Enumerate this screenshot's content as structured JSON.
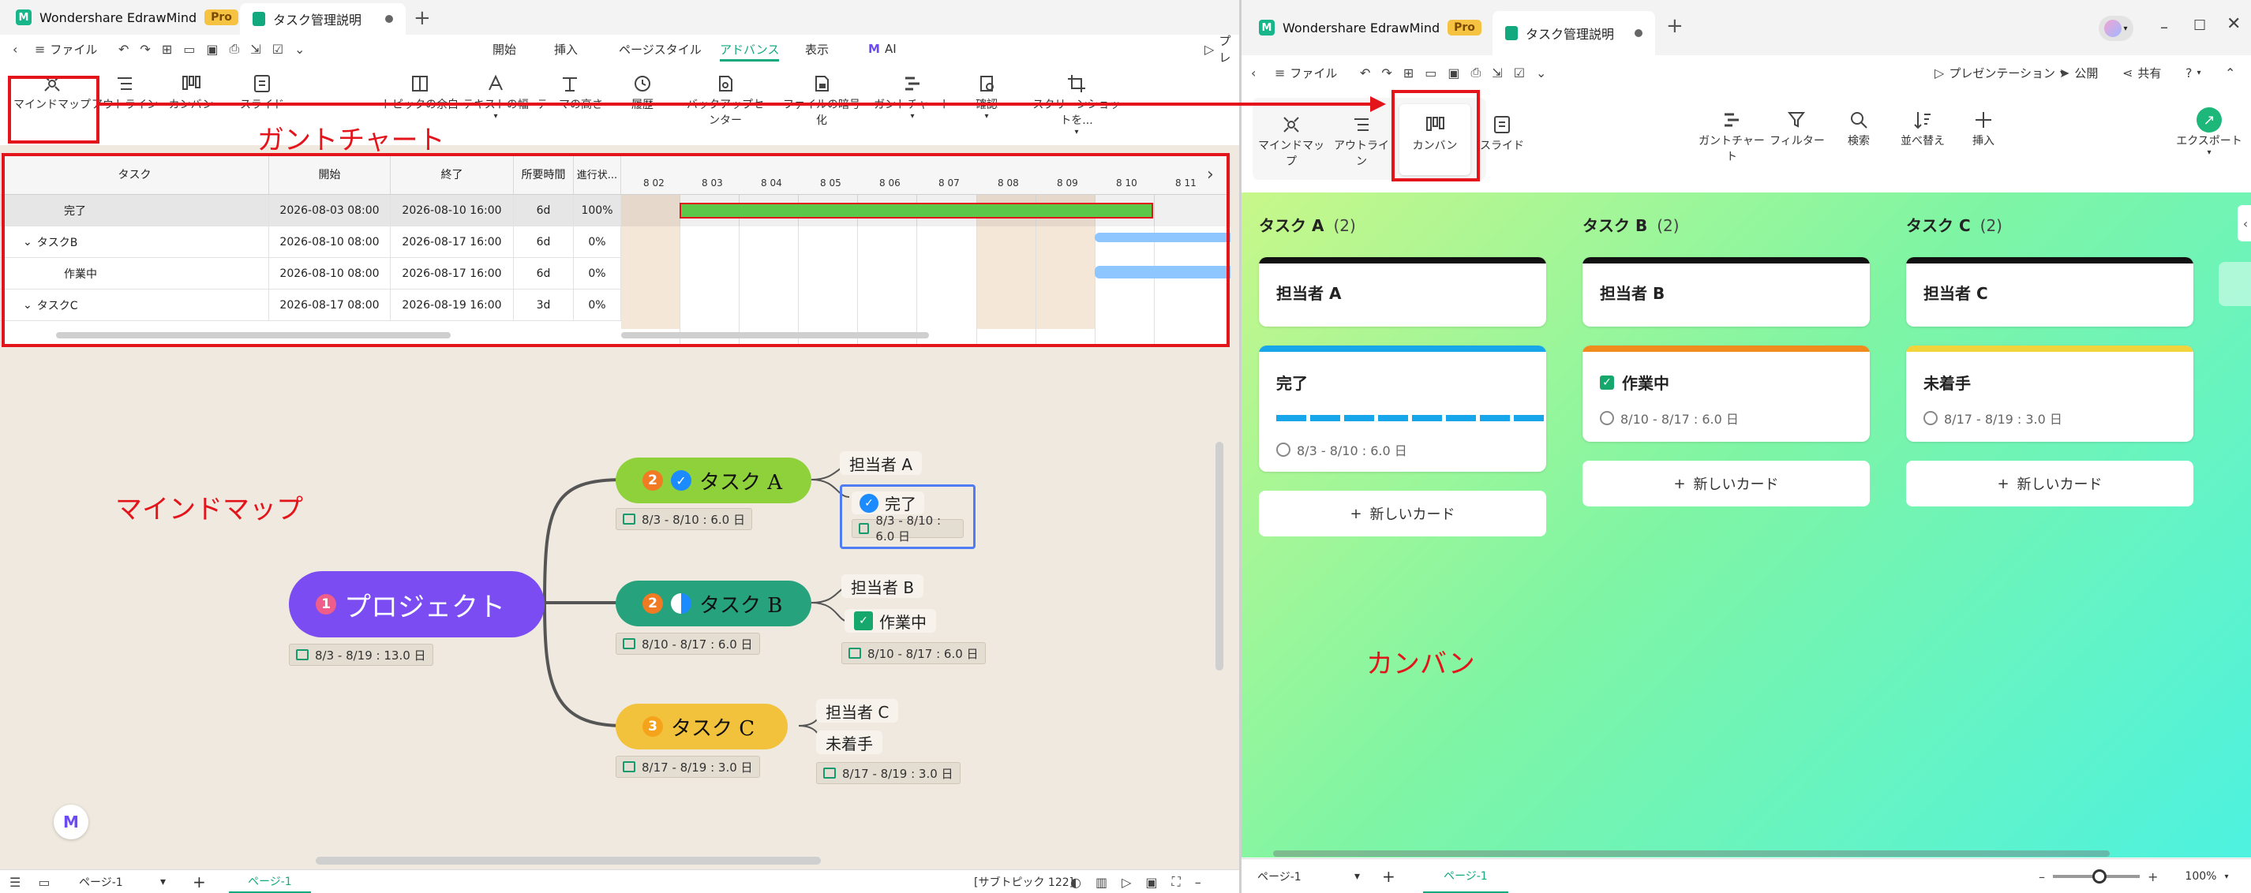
{
  "left_window": {
    "app_name": "Wondershare EdrawMind",
    "pro_label": "Pro",
    "tab_title": "タスク管理説明",
    "menu": {
      "file": "ファイル",
      "tabs": [
        "開始",
        "挿入",
        "ページスタイル",
        "アドバンス",
        "表示",
        "AI"
      ],
      "active_tab": "アドバンス",
      "present": "プレ"
    },
    "ribbon_views": [
      "マインドマップ",
      "アウトライン",
      "カンバン",
      "スライド"
    ],
    "ribbon_tools": [
      "トピックの余白",
      "テキストの幅",
      "テーマの高さ",
      "履歴",
      "バックアップセンター",
      "ファイルの暗号化",
      "ガントチャート",
      "確認",
      "スクリーンショットを..."
    ],
    "annotation_gantt": "ガントチャート",
    "annotation_mindmap": "マインドマップ",
    "gantt": {
      "headers": [
        "タスク",
        "開始",
        "終了",
        "所要時間",
        "進行状..."
      ],
      "dates": [
        "8 02",
        "8 03",
        "8 04",
        "8 05",
        "8 06",
        "8 07",
        "8 08",
        "8 09",
        "8 10",
        "8 11"
      ],
      "rows": [
        {
          "task": "完了",
          "start": "2026-08-03 08:00",
          "end": "2026-08-10 16:00",
          "duration": "6d",
          "progress": "100%"
        },
        {
          "task": "タスクB",
          "start": "2026-08-10 08:00",
          "end": "2026-08-17 16:00",
          "duration": "6d",
          "progress": "0%"
        },
        {
          "task": "作業中",
          "start": "2026-08-10 08:00",
          "end": "2026-08-17 16:00",
          "duration": "6d",
          "progress": "0%"
        },
        {
          "task": "タスクC",
          "start": "2026-08-17 08:00",
          "end": "2026-08-19 16:00",
          "duration": "3d",
          "progress": "0%"
        }
      ]
    },
    "mindmap": {
      "root": {
        "badge": "1",
        "title": "プロジェクト",
        "dates": "8/3 - 8/19 : 13.0 日"
      },
      "task_a": {
        "badge": "2",
        "title": "タスク A",
        "dates": "8/3 - 8/10 : 6.0 日",
        "assignee": "担当者 A",
        "status": "完了",
        "status_dates": "8/3 - 8/10 : 6.0 日"
      },
      "task_b": {
        "badge": "2",
        "title": "タスク B",
        "dates": "8/10 - 8/17 : 6.0 日",
        "assignee": "担当者 B",
        "status": "作業中",
        "status_dates": "8/10 - 8/17 : 6.0 日"
      },
      "task_c": {
        "badge": "3",
        "title": "タスク C",
        "dates": "8/17 - 8/19 : 3.0 日",
        "assignee": "担当者 C",
        "status": "未着手",
        "status_dates": "8/17 - 8/19 : 3.0 日"
      }
    },
    "statusbar": {
      "page_select": "ページ-1",
      "page_tab": "ページ-1",
      "subtopic": "[サブトピック 122]"
    }
  },
  "right_window": {
    "app_name": "Wondershare EdrawMind",
    "pro_label": "Pro",
    "tab_title": "タスク管理説明",
    "menu": {
      "file": "ファイル",
      "presentation": "プレゼンテーション",
      "publish": "公開",
      "share": "共有"
    },
    "views": [
      "マインドマップ",
      "アウトライン",
      "カンバン",
      "スライド"
    ],
    "tools": [
      "ガントチャート",
      "フィルター",
      "検索",
      "並べ替え",
      "挿入"
    ],
    "export": "エクスポート",
    "annotation": "カンバン",
    "columns": [
      {
        "title": "タスク A",
        "count": "(2)",
        "assignee": "担当者 A",
        "card": "完了",
        "dates": "8/3 - 8/10 : 6.0 日"
      },
      {
        "title": "タスク B",
        "count": "(2)",
        "assignee": "担当者 B",
        "card": "作業中",
        "dates": "8/10 - 8/17 : 6.0 日"
      },
      {
        "title": "タスク C",
        "count": "(2)",
        "assignee": "担当者 C",
        "card": "未着手",
        "dates": "8/17 - 8/19 : 3.0 日"
      }
    ],
    "new_card": "新しいカード",
    "statusbar": {
      "page_select": "ページ-1",
      "page_tab": "ページ-1",
      "zoom": "100%"
    }
  },
  "colors": {
    "accent": "#12a97f",
    "annotation_red": "#e4141b",
    "root": "#7b4cf2",
    "task_a": "#8fd13a",
    "task_b": "#26a37c",
    "task_c": "#f2c23c",
    "gantt_bar": "#5cc84a",
    "gantt_blue": "#8ec6ff"
  }
}
